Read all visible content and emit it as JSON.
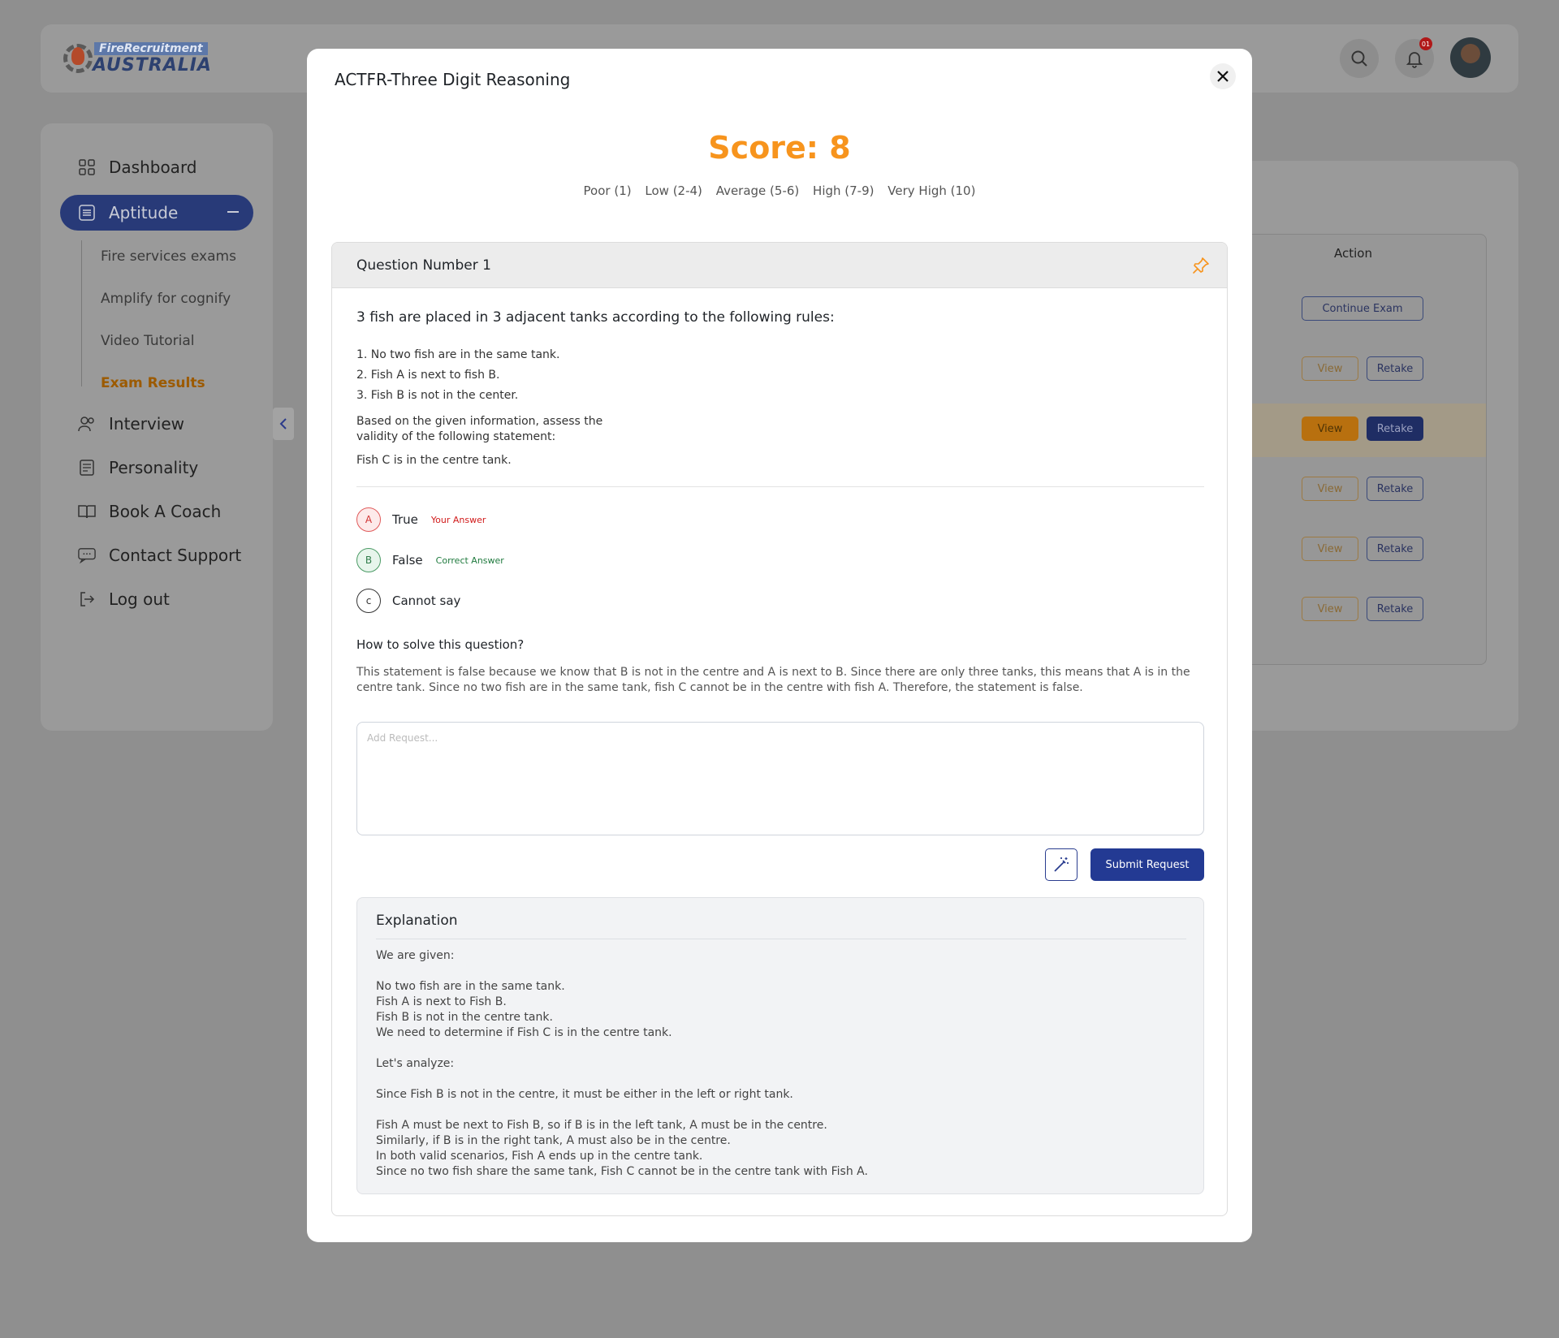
{
  "brand": {
    "line1": "FireRecruitment",
    "line2": "AUSTRALIA"
  },
  "header": {
    "notification_count": "01"
  },
  "sidebar": {
    "items": [
      {
        "label": "Dashboard",
        "icon": "grid-icon"
      },
      {
        "label": "Aptitude",
        "icon": "list-icon"
      },
      {
        "label": "Interview",
        "icon": "users-icon"
      },
      {
        "label": "Personality",
        "icon": "form-icon"
      },
      {
        "label": "Book A Coach",
        "icon": "book-icon"
      },
      {
        "label": "Contact Support",
        "icon": "chat-icon"
      },
      {
        "label": "Log out",
        "icon": "logout-icon"
      }
    ],
    "sub_items": [
      {
        "label": "Fire services exams"
      },
      {
        "label": "Amplify for cognify"
      },
      {
        "label": "Video Tutorial"
      },
      {
        "label": "Exam Results"
      }
    ]
  },
  "table": {
    "action_header": "Action",
    "continue_label": "Continue Exam",
    "view_label": "View",
    "retake_label": "Retake"
  },
  "modal": {
    "title": "ACTFR-Three Digit Reasoning",
    "score_text": "Score: 8",
    "score_levels": [
      "Poor (1)",
      "Low (2-4)",
      "Average (5-6)",
      "High (7-9)",
      "Very High (10)"
    ],
    "question": {
      "header": "Question Number 1",
      "stem": "3 fish are placed in 3 adjacent tanks according to the following rules:",
      "rules": [
        "1. No two fish are in the same tank.",
        "2. Fish A is next to fish B.",
        "3. Fish B is not in the center."
      ],
      "assess": "Based on the given information, assess the validity of the following statement:",
      "statement": "Fish C is in the centre tank.",
      "options": [
        {
          "letter": "A",
          "label": "True",
          "tag": "Your Answer"
        },
        {
          "letter": "B",
          "label": "False",
          "tag": "Correct Answer"
        },
        {
          "letter": "c",
          "label": "Cannot say",
          "tag": ""
        }
      ],
      "how_title": "How to solve this question?",
      "how_text": "This statement is false because we know that B is not in the centre and A is next to B. Since there are only three tanks, this means that A is in the centre tank. Since no two fish are in the same tank, fish C cannot be in the centre  with fish A. Therefore, the statement is false.",
      "request_placeholder": "Add Request...",
      "submit_label": "Submit Request",
      "explanation": {
        "title": "Explanation",
        "intro": "We are given:",
        "given": [
          "No two fish are in the same tank.",
          "Fish A is next to Fish B.",
          "Fish B is not in the centre tank.",
          "We need to determine if Fish C is in the centre tank."
        ],
        "analyze": "Let's analyze:",
        "step1": "Since Fish B is not in the centre, it must be either in the left or right tank.",
        "steps": [
          "Fish A must be next to Fish B, so if B is in the left tank, A must be in the centre.",
          "Similarly, if B is in the right tank, A must also be in the centre.",
          "In both valid scenarios, Fish A ends up in the centre tank.",
          "Since no two fish share the same tank, Fish C cannot be in the centre tank with Fish A."
        ]
      }
    }
  },
  "colors": {
    "score": "#f7941d",
    "primary": "#233a93",
    "wrong": "#d11a1a",
    "correct": "#1f7a3e"
  }
}
